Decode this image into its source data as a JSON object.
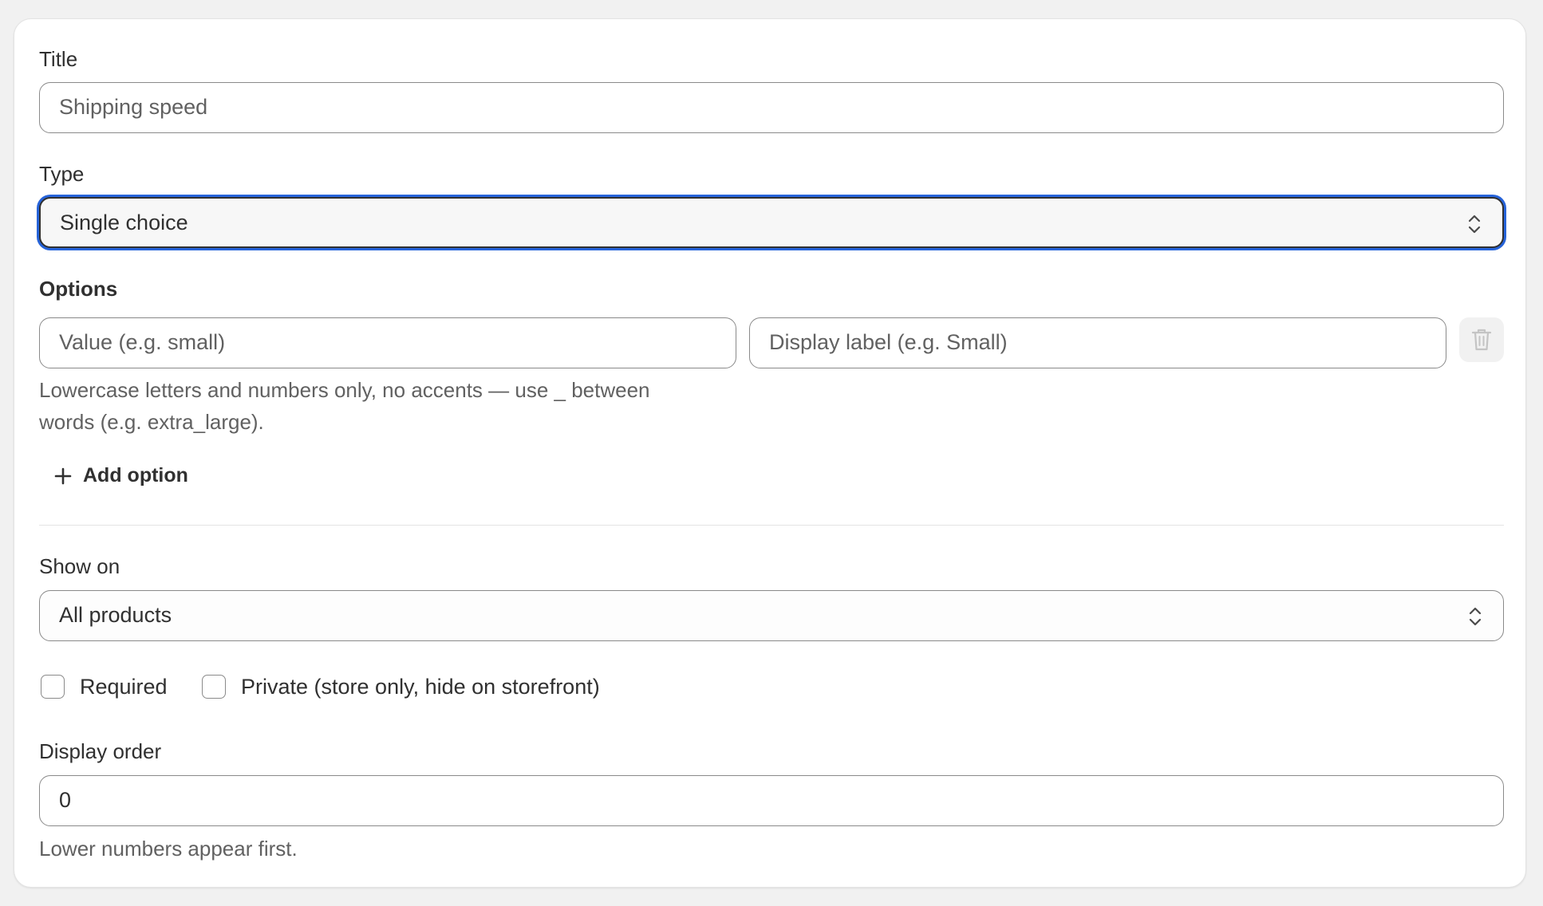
{
  "form": {
    "title": {
      "label": "Title",
      "value": "Shipping speed"
    },
    "type": {
      "label": "Type",
      "selected": "Single choice"
    },
    "options": {
      "label": "Options",
      "value_placeholder": "Value (e.g. small)",
      "display_placeholder": "Display label (e.g. Small)",
      "help_line1": "Lowercase letters and numbers only, no accents — use _ between",
      "help_line2": "words (e.g. extra_large).",
      "add_label": "Add option"
    },
    "show_on": {
      "label": "Show on",
      "selected": "All products"
    },
    "checkboxes": {
      "required_label": "Required",
      "private_label": "Private (store only, hide on storefront)"
    },
    "display_order": {
      "label": "Display order",
      "value": "0",
      "help": "Lower numbers appear first."
    }
  },
  "colors": {
    "focus_ring": "#2663d9",
    "text": "#303030",
    "muted_text": "#616161",
    "border": "#8a8a8a",
    "background": "#f1f1f1"
  },
  "icons": {
    "select": "chevron-up-down-icon",
    "delete": "trash-icon",
    "add": "plus-icon"
  }
}
